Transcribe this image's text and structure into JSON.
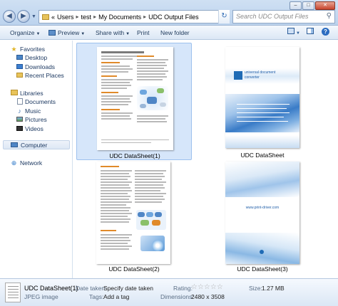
{
  "window": {
    "controls": {
      "minimize": "–",
      "maximize": "□",
      "close": "✕"
    }
  },
  "navigation": {
    "back_icon": "back-arrow-icon",
    "forward_icon": "forward-arrow-icon",
    "breadcrumbs": [
      "Users",
      "test",
      "My Documents",
      "UDC Output Files"
    ],
    "lead_chevron": "«",
    "separator": "▸",
    "search_placeholder": "Search UDC Output Files"
  },
  "toolbar": {
    "organize": "Organize",
    "preview": "Preview",
    "share_with": "Share with",
    "print": "Print",
    "new_folder": "New folder"
  },
  "sidebar": {
    "favorites": "Favorites",
    "favorites_items": [
      "Desktop",
      "Downloads",
      "Recent Places"
    ],
    "libraries": "Libraries",
    "libraries_items": [
      "Documents",
      "Music",
      "Pictures",
      "Videos"
    ],
    "computer": "Computer",
    "network": "Network"
  },
  "files": [
    {
      "name": "UDC DataSheet(1)",
      "selected": true
    },
    {
      "name": "UDC DataSheet",
      "selected": false
    },
    {
      "name": "UDC DataSheet(2)",
      "selected": false
    },
    {
      "name": "UDC DataSheet(3)",
      "selected": false
    }
  ],
  "cover": {
    "brand_line1": "universal document",
    "brand_line2": "converter",
    "url": "www.print-driver.com"
  },
  "details": {
    "file_name": "UDC DataSheet(1)",
    "file_type": "JPEG image",
    "date_taken_label": "Date taken:",
    "date_taken_value": "Specify date taken",
    "tags_label": "Tags:",
    "tags_value": "Add a tag",
    "rating_label": "Rating:",
    "rating_stars": "☆☆☆☆☆",
    "dimensions_label": "Dimensions:",
    "dimensions_value": "2480 x 3508",
    "size_label": "Size:",
    "size_value": "1.27 MB"
  },
  "colors": {
    "accent": "#1f6bb5",
    "selection": "#d6e6fa",
    "section_title": "#e08a2a"
  }
}
